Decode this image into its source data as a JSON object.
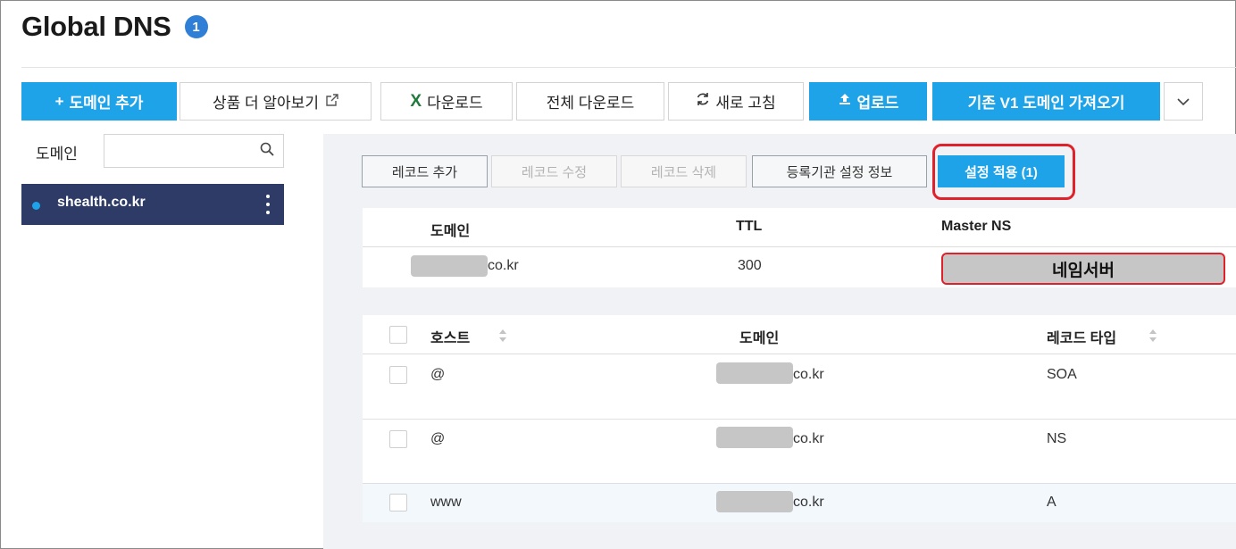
{
  "header": {
    "title": "Global DNS",
    "info_badge": "1"
  },
  "toolbar": {
    "add_domain": "도메인 추가",
    "learn_more": "상품 더 알아보기",
    "download": "다운로드",
    "download_all": "전체 다운로드",
    "refresh": "새로 고침",
    "upload": "업로드",
    "import_v1": "기존 V1 도메인 가져오기"
  },
  "sidebar": {
    "label": "도메인",
    "search_placeholder": "",
    "domains": [
      {
        "name": "shealth.co.kr",
        "selected": true
      }
    ]
  },
  "record_toolbar": {
    "add": "레코드 추가",
    "edit": "레코드 수정",
    "delete": "레코드 삭제",
    "registrar_info": "등록기관 설정 정보",
    "apply": "설정 적용 (1)"
  },
  "domain_table": {
    "headers": {
      "domain": "도메인",
      "ttl": "TTL",
      "master_ns": "Master NS"
    },
    "row": {
      "domain_suffix": "co.kr",
      "ttl": "300",
      "master_ns": "네임서버"
    }
  },
  "record_table": {
    "headers": {
      "host": "호스트",
      "domain": "도메인",
      "type": "레코드 타입"
    },
    "rows": [
      {
        "host": "@",
        "domain_suffix": "co.kr",
        "type": "SOA"
      },
      {
        "host": "@",
        "domain_suffix": "co.kr",
        "type": "NS"
      },
      {
        "host": "www",
        "domain_suffix": "co.kr",
        "type": "A"
      }
    ]
  },
  "colors": {
    "primary": "#1fa3e8",
    "sidebar_selected": "#2e3b66",
    "highlight": "#e0212b"
  }
}
